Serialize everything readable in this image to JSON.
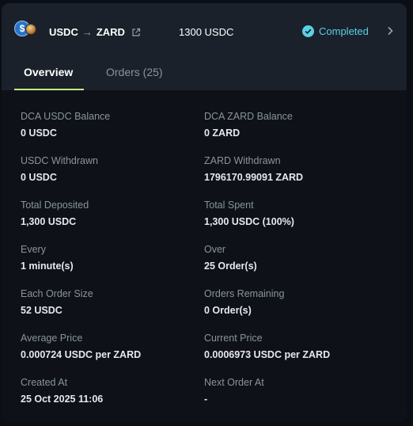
{
  "header": {
    "from_token": "USDC",
    "arrow": "→",
    "to_token": "ZARD",
    "amount": "1300 USDC",
    "status": "Completed",
    "icons": {
      "usdc": "usdc-coin-icon",
      "zard": "zard-coin-icon",
      "external_link": "external-link-icon",
      "status": "check-circle-icon",
      "expand": "chevron-right-icon"
    },
    "usdc_glyph": "$"
  },
  "tabs": [
    {
      "label": "Overview",
      "active": true
    },
    {
      "label": "Orders (25)",
      "active": false
    }
  ],
  "fields": [
    {
      "label": "DCA USDC Balance",
      "value": "0 USDC"
    },
    {
      "label": "DCA ZARD Balance",
      "value": "0 ZARD"
    },
    {
      "label": "USDC Withdrawn",
      "value": "0 USDC"
    },
    {
      "label": "ZARD Withdrawn",
      "value": "1796170.99091 ZARD"
    },
    {
      "label": "Total Deposited",
      "value": "1,300 USDC"
    },
    {
      "label": "Total Spent",
      "value": "1,300 USDC (100%)"
    },
    {
      "label": "Every",
      "value": "1 minute(s)"
    },
    {
      "label": "Over",
      "value": "25 Order(s)"
    },
    {
      "label": "Each Order Size",
      "value": "52 USDC"
    },
    {
      "label": "Orders Remaining",
      "value": "0 Order(s)"
    },
    {
      "label": "Average Price",
      "value": "0.000724 USDC per ZARD"
    },
    {
      "label": "Current Price",
      "value": "0.0006973 USDC per ZARD"
    },
    {
      "label": "Created At",
      "value": "25 Oct 2025 11:06"
    },
    {
      "label": "Next Order At",
      "value": "-"
    }
  ],
  "colors": {
    "accent_tab_underline": "#c7f284",
    "status_completed": "#5ad0e6",
    "usdc_blue": "#2775ca"
  }
}
